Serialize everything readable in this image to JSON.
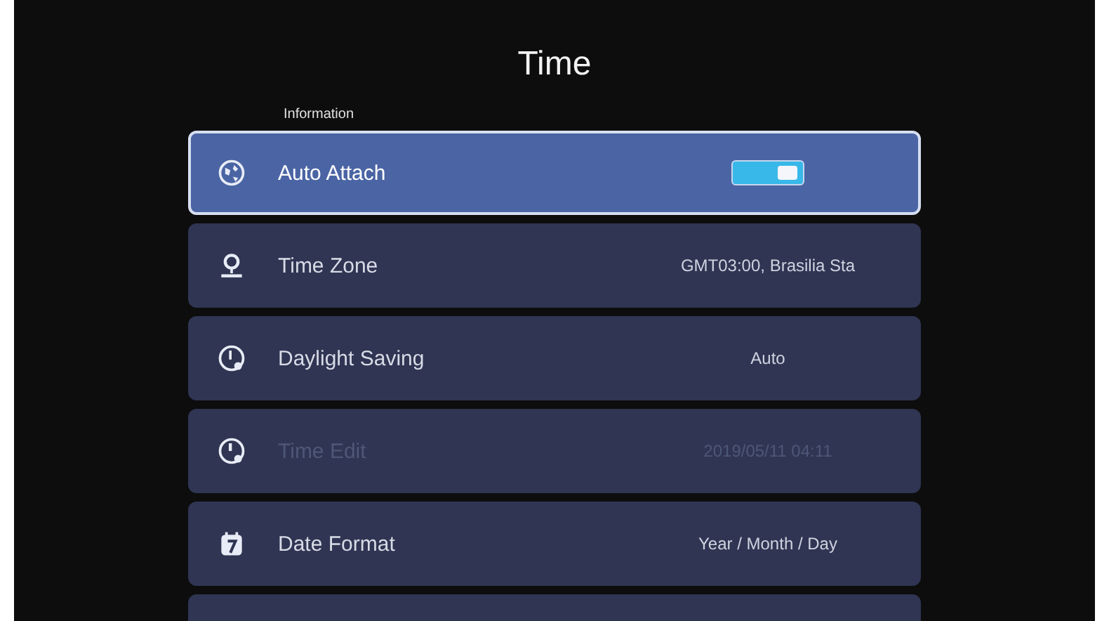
{
  "title": "Time",
  "section": "Information",
  "rows": [
    {
      "kind": "toggle",
      "label": "Auto Attach",
      "on": true,
      "selected": true,
      "disabled": false
    },
    {
      "kind": "value",
      "label": "Time Zone",
      "value": "GMT03:00, Brasilia Sta",
      "selected": false,
      "disabled": false
    },
    {
      "kind": "value",
      "label": "Daylight Saving",
      "value": "Auto",
      "selected": false,
      "disabled": false
    },
    {
      "kind": "value",
      "label": "Time Edit",
      "value": "2019/05/11 04:11",
      "selected": false,
      "disabled": true
    },
    {
      "kind": "value",
      "label": "Date Format",
      "value": "Year / Month / Day",
      "selected": false,
      "disabled": false
    }
  ]
}
